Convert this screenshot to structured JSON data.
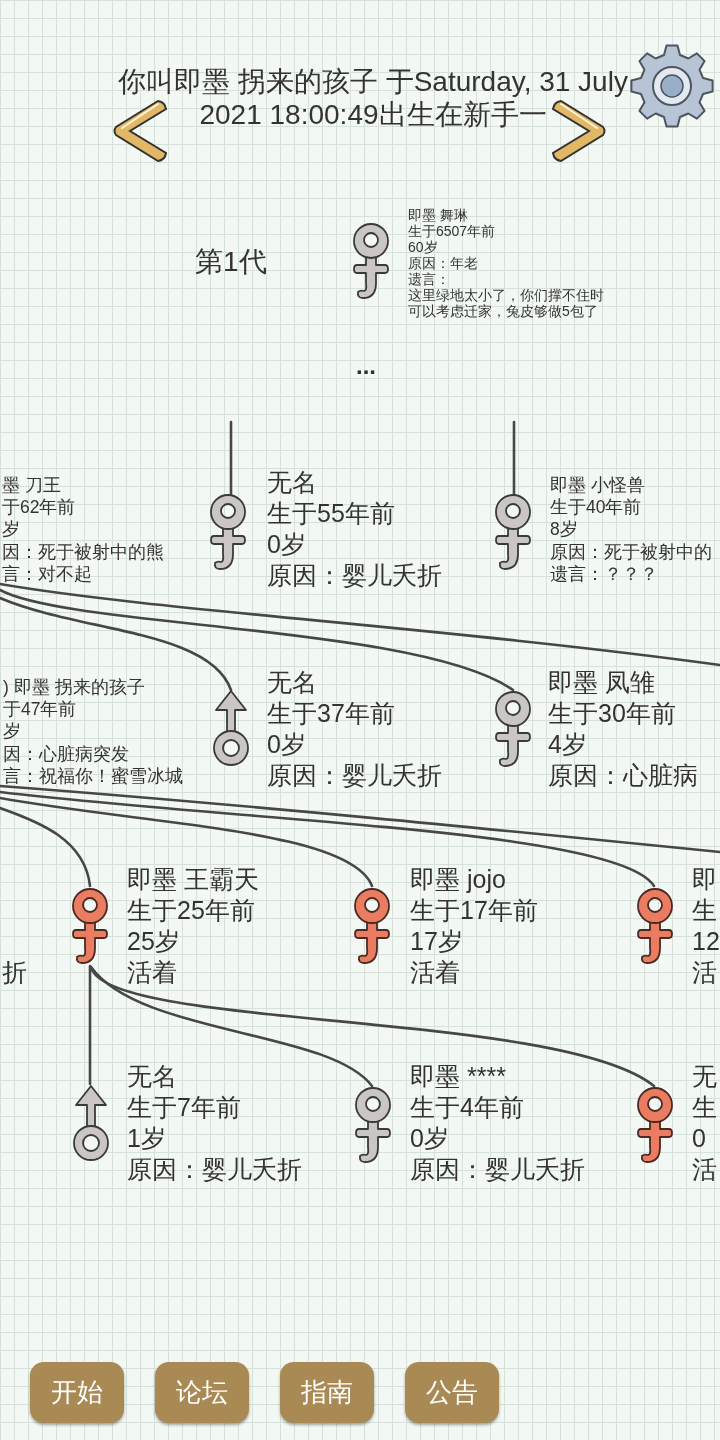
{
  "header": {
    "title_lines": [
      "你叫即墨 拐来的孩子 于Saturday, 31 July",
      "2021 18:00:49出生在新手一"
    ]
  },
  "generation": {
    "label": "第1代",
    "ancestor": {
      "kind": "female",
      "alive": false,
      "name": "即墨 舞琳",
      "born": "生于6507年前",
      "age": "60岁",
      "status": "原因：年老",
      "will": "遗言：",
      "will_text": "这里绿地太小了，你们撑不住时可以考虑迁家，兔皮够做5包了"
    }
  },
  "ellipsis": "...",
  "rows": [
    {
      "members": [
        {
          "name": "墨 刀王",
          "born": "于62年前",
          "age": "岁",
          "status": "因：死于被射中的熊",
          "will": "言：对不起"
        },
        {
          "kind": "female",
          "alive": false,
          "name": "无名",
          "born": "生于55年前",
          "age": "0岁",
          "status": "原因：婴儿夭折"
        },
        {
          "kind": "female",
          "alive": false,
          "name": "即墨 小怪兽",
          "born": "生于40年前",
          "age": "8岁",
          "status": "原因：死于被射中的",
          "will": "遗言：？？？"
        }
      ]
    },
    {
      "members": [
        {
          "name": ") 即墨 拐来的孩子",
          "born": "于47年前",
          "age": "岁",
          "status": "因：心脏病突发",
          "will": "言：祝福你！蜜雪冰城"
        },
        {
          "kind": "male",
          "alive": false,
          "name": "无名",
          "born": "生于37年前",
          "age": "0岁",
          "status": "原因：婴儿夭折"
        },
        {
          "kind": "female",
          "alive": false,
          "name": "即墨 凤雏",
          "born": "生于30年前",
          "age": "4岁",
          "status": "原因：心脏病"
        }
      ]
    },
    {
      "members": [
        {
          "status": "折"
        },
        {
          "kind": "female",
          "alive": true,
          "name": "即墨 王霸天",
          "born": "生于25年前",
          "age": "25岁",
          "status": "活着"
        },
        {
          "kind": "female",
          "alive": true,
          "name": "即墨 jojo",
          "born": "生于17年前",
          "age": "17岁",
          "status": "活着"
        },
        {
          "kind": "female",
          "alive": true,
          "name": "即",
          "born": "生",
          "age": "12",
          "status": "活"
        }
      ]
    },
    {
      "members": [
        {
          "kind": "male",
          "alive": false,
          "name": "无名",
          "born": "生于7年前",
          "age": "1岁",
          "status": "原因：婴儿夭折"
        },
        {
          "kind": "female",
          "alive": false,
          "name": "即墨 ****",
          "born": "生于4年前",
          "age": "0岁",
          "status": "原因：婴儿夭折"
        },
        {
          "kind": "female",
          "alive": true,
          "name": "无",
          "born": "生",
          "age": "0",
          "status": "活"
        }
      ]
    }
  ],
  "buttons": [
    {
      "label": "开始"
    },
    {
      "label": "论坛"
    },
    {
      "label": "指南"
    },
    {
      "label": "公告"
    }
  ]
}
